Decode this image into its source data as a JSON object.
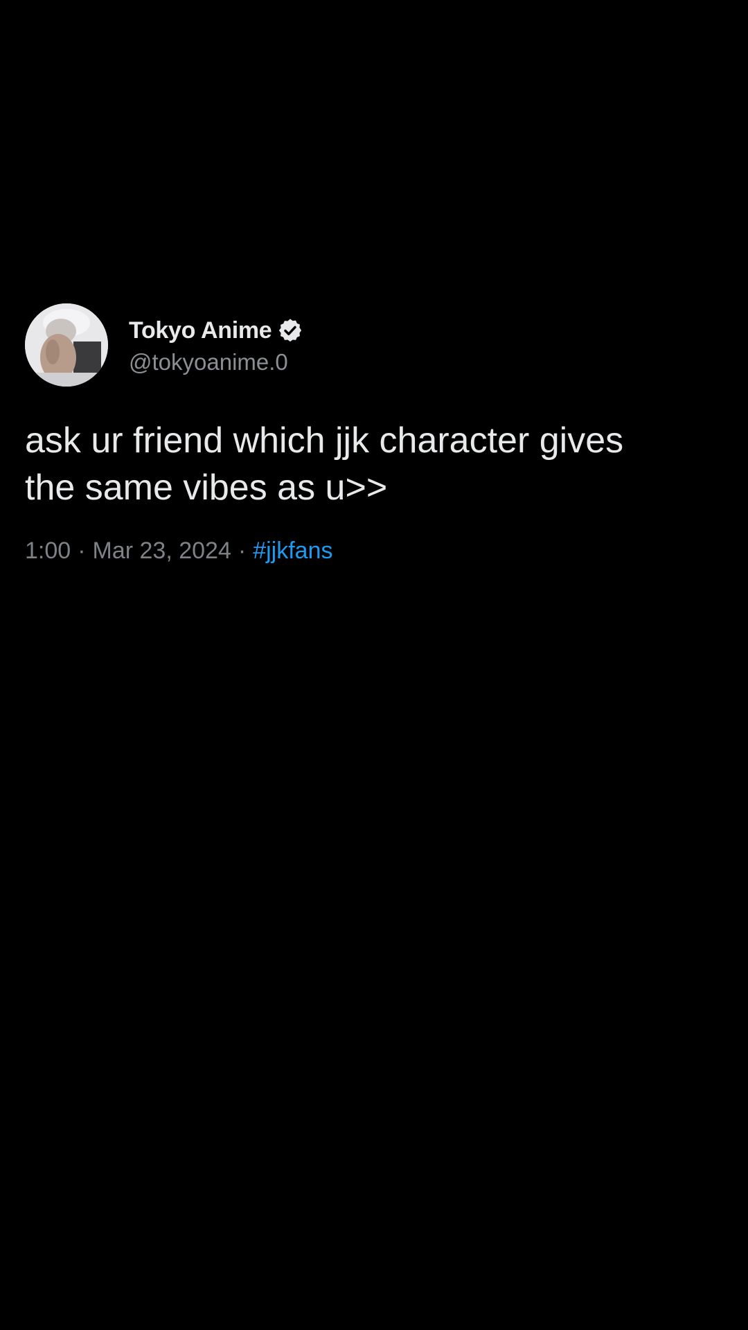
{
  "tweet": {
    "display_name": "Tokyo Anime",
    "handle": "@tokyoanime.0",
    "verified": true,
    "text": "ask ur friend which jjk character gives\nthe same vibes as u>>",
    "time": "1:00",
    "separator": "·",
    "date": "Mar 23, 2024",
    "hashtag": "#jjkfans"
  },
  "colors": {
    "background": "#000000",
    "text": "#e7e9ea",
    "muted": "#8b8f94",
    "link": "#1d9bf0"
  },
  "icons": {
    "verified": "verified-badge-icon",
    "avatar": "profile-avatar"
  }
}
